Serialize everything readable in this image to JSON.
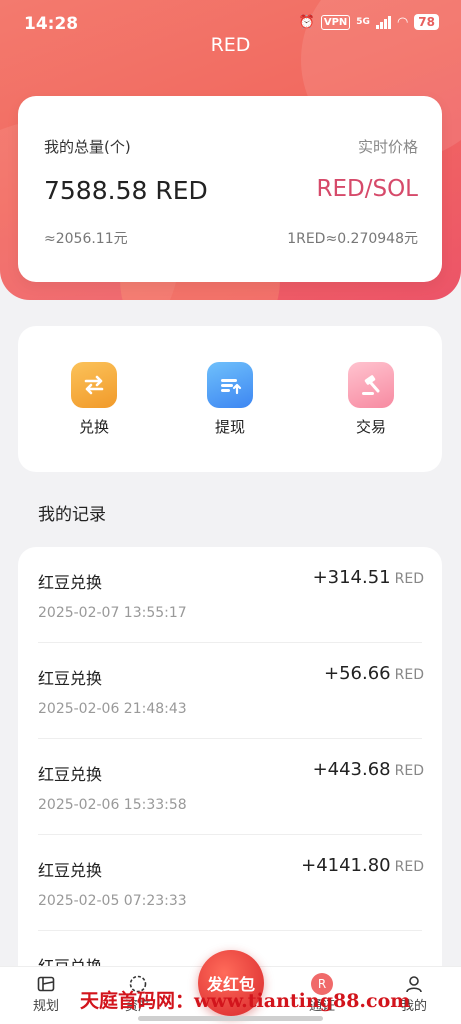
{
  "status": {
    "time": "14:28",
    "vpn": "VPN",
    "network": "5G",
    "battery": "78"
  },
  "app_title": "RED",
  "summary": {
    "total_label": "我的总量(个)",
    "price_label": "实时价格",
    "total_value": "7588.58 RED",
    "pair": "RED/SOL",
    "cny_value": "≈2056.11元",
    "rate": "1RED≈0.270948元"
  },
  "actions": [
    {
      "label": "兑换",
      "icon": "exchange-icon",
      "color": "#f5a22c"
    },
    {
      "label": "提现",
      "icon": "withdraw-icon",
      "color": "#4a9cf5"
    },
    {
      "label": "交易",
      "icon": "auction-hammer-icon",
      "color": "#f58aa0"
    }
  ],
  "records_title": "我的记录",
  "records": [
    {
      "name": "红豆兑换",
      "time": "2025-02-07 13:55:17",
      "amount": "+314.51",
      "unit": "RED"
    },
    {
      "name": "红豆兑换",
      "time": "2025-02-06 21:48:43",
      "amount": "+56.66",
      "unit": "RED"
    },
    {
      "name": "红豆兑换",
      "time": "2025-02-06 15:33:58",
      "amount": "+443.68",
      "unit": "RED"
    },
    {
      "name": "红豆兑换",
      "time": "2025-02-05 07:23:33",
      "amount": "+4141.80",
      "unit": "RED"
    },
    {
      "name": "红豆兑换",
      "time": "",
      "amount": "",
      "unit": ""
    }
  ],
  "tabbar": {
    "tabs": [
      {
        "label": "规划",
        "icon": "map-icon"
      },
      {
        "label": "资产",
        "icon": "asset-icon"
      },
      {
        "label": "通证",
        "icon": "token-icon"
      },
      {
        "label": "我的",
        "icon": "person-icon"
      }
    ],
    "center_label": "发红包"
  },
  "watermark": "天庭首码网：www.tianting88.com"
}
